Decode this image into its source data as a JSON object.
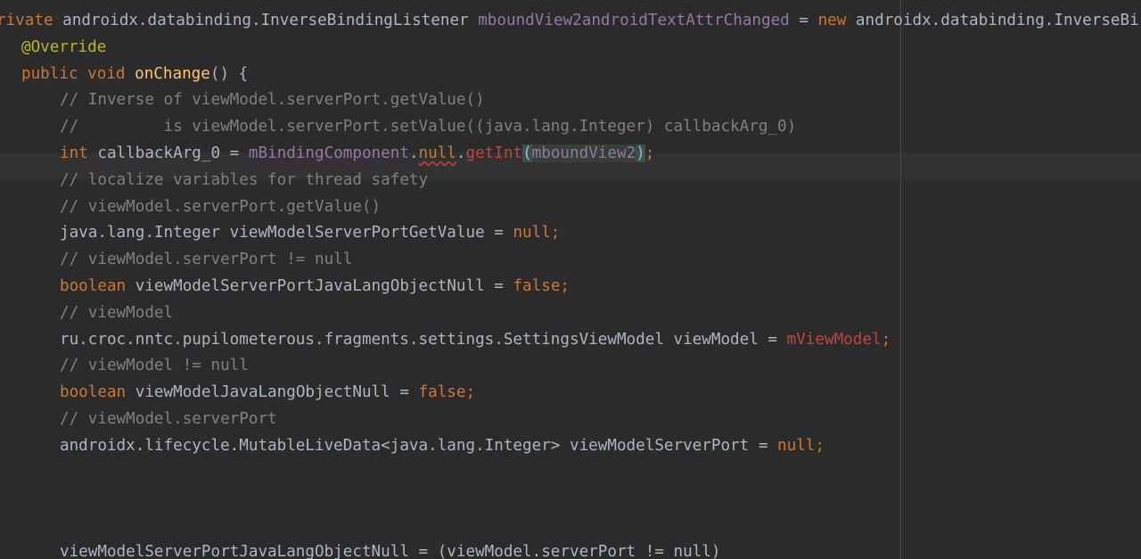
{
  "editor": {
    "lines": [
      [
        {
          "text": "rivate",
          "role": "keyword"
        },
        {
          "text": " androidx.databinding.InverseBindingListener ",
          "role": "plain"
        },
        {
          "text": "mboundView2androidTextAttrChanged",
          "role": "field"
        },
        {
          "text": " = ",
          "role": "plain"
        },
        {
          "text": "new",
          "role": "keyword"
        },
        {
          "text": " androidx.databinding.InverseBi",
          "role": "plain"
        }
      ],
      [
        {
          "text": "@Override",
          "role": "anno"
        }
      ],
      [
        {
          "text": "public void ",
          "role": "keyword"
        },
        {
          "text": "onChange",
          "role": "method"
        },
        {
          "text": "() {",
          "role": "plain"
        }
      ],
      [
        {
          "text": "// Inverse of viewModel.serverPort.getValue()",
          "role": "comment"
        }
      ],
      [
        {
          "text": "//         is viewModel.serverPort.setValue((java.lang.Integer) callbackArg_0)",
          "role": "comment"
        }
      ],
      [
        {
          "text": "int ",
          "role": "keyword"
        },
        {
          "text": "callbackArg_0 = ",
          "role": "plain"
        },
        {
          "text": "mBindingComponent",
          "role": "field"
        },
        {
          "text": ".",
          "role": "plain"
        },
        {
          "text": "null",
          "role": "err"
        },
        {
          "text": ".",
          "role": "plain"
        },
        {
          "text": "getInt",
          "role": "errref"
        },
        {
          "text": "(",
          "role": "bracematch"
        },
        {
          "text": "mboundView2",
          "role": "usage"
        },
        {
          "text": ")",
          "role": "bracematch"
        },
        {
          "text": ";",
          "role": "keyword"
        }
      ],
      [
        {
          "text": "// localize variables for thread safety",
          "role": "comment"
        }
      ],
      [
        {
          "text": "// viewModel.serverPort.getValue()",
          "role": "comment"
        }
      ],
      [
        {
          "text": "java.lang.Integer viewModelServerPortGetValue = ",
          "role": "plain"
        },
        {
          "text": "null;",
          "role": "keyword"
        }
      ],
      [
        {
          "text": "// viewModel.serverPort != null",
          "role": "comment"
        }
      ],
      [
        {
          "text": "boolean ",
          "role": "keyword"
        },
        {
          "text": "viewModelServerPortJavaLangObjectNull = ",
          "role": "plain"
        },
        {
          "text": "false;",
          "role": "keyword"
        }
      ],
      [
        {
          "text": "// viewModel",
          "role": "comment"
        }
      ],
      [
        {
          "text": "ru.croc.nntc.pupilometerous.fragments.settings.SettingsViewModel viewModel = ",
          "role": "plain"
        },
        {
          "text": "mViewModel",
          "role": "errref"
        },
        {
          "text": ";",
          "role": "keyword"
        }
      ],
      [
        {
          "text": "// viewModel != null",
          "role": "comment"
        }
      ],
      [
        {
          "text": "boolean ",
          "role": "keyword"
        },
        {
          "text": "viewModelJavaLangObjectNull = ",
          "role": "plain"
        },
        {
          "text": "false;",
          "role": "keyword"
        }
      ],
      [
        {
          "text": "// viewModel.serverPort",
          "role": "comment"
        }
      ],
      [
        {
          "text": "androidx.lifecycle.MutableLiveData<java.lang.Integer> viewModelServerPort = ",
          "role": "plain"
        },
        {
          "text": "null;",
          "role": "keyword"
        }
      ],
      [],
      [],
      [],
      [
        {
          "text": "viewModelServerPortJavaLangObjectNull = (viewModel.serverPort != null)",
          "role": "partial"
        }
      ]
    ]
  }
}
